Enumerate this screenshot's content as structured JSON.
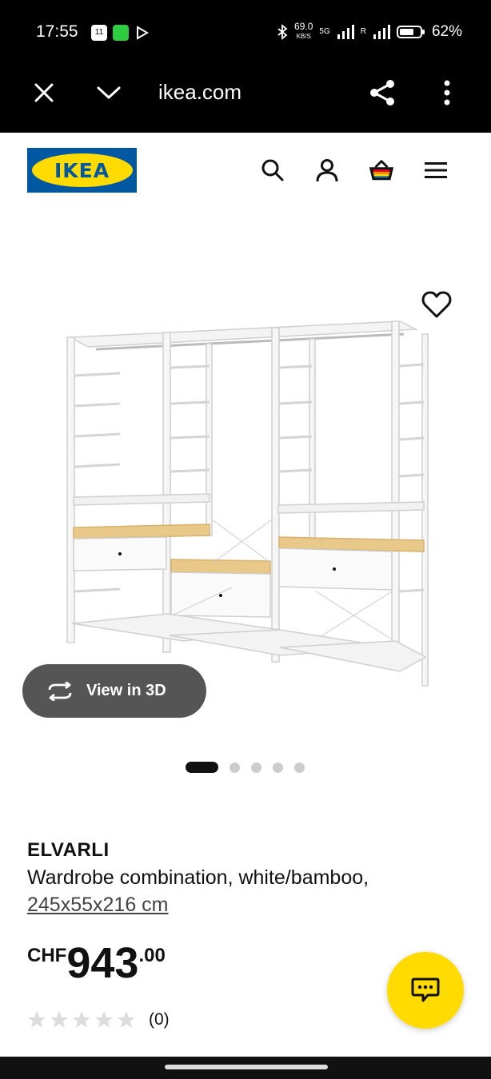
{
  "status_bar": {
    "time": "17:55",
    "notif_badge": "11",
    "net_speed_value": "69.0",
    "net_speed_unit": "KB/S",
    "network": "5G",
    "roaming": "R",
    "battery": "62%"
  },
  "browser": {
    "url": "ikea.com",
    "close_icon": "close-icon",
    "collapse_icon": "chevron-down-icon",
    "share_icon": "share-icon",
    "menu_icon": "more-vertical-icon"
  },
  "header": {
    "logo_text": "IKEA",
    "brand_blue": "#0058a3",
    "brand_yellow": "#ffdb00"
  },
  "gallery": {
    "view_3d_label": "View in 3D",
    "dot_count": 5,
    "active_dot": 0
  },
  "product": {
    "name": "ELVARLI",
    "description": "Wardrobe combination, white/bamboo,",
    "dimensions": "245x55x216 cm",
    "currency": "CHF",
    "price_integer": "943",
    "price_decimal": ".00",
    "rating_stars": 0,
    "rating_max": 5,
    "review_count": "(0)"
  }
}
